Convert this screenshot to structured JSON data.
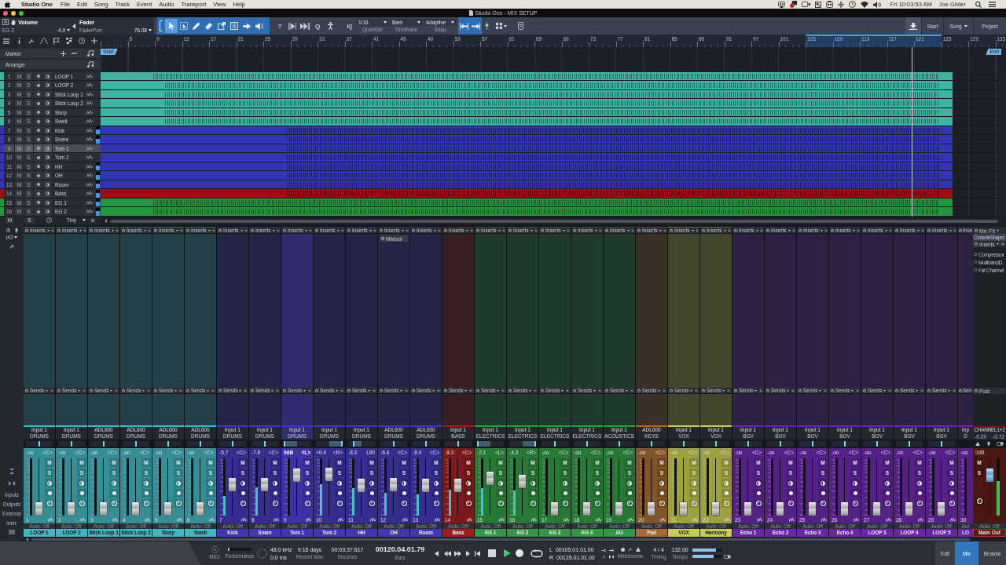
{
  "menu_bar": {
    "app": "Studio One",
    "items": [
      "File",
      "Edit",
      "Song",
      "Track",
      "Event",
      "Audio",
      "Transport",
      "View",
      "Help"
    ],
    "clock": "Fri 10:03:53 AM",
    "user": "Joe Gilder"
  },
  "window": {
    "title": "Studio One - MIX SETUP"
  },
  "toolbar": {
    "parameter": {
      "badge": "A",
      "name": "Volume",
      "track": "EG 2",
      "value": "-4.0"
    },
    "controller": {
      "name": "Fader",
      "device": "FaderPort",
      "value": "76.08"
    },
    "tools": [
      {
        "kind": "arrow",
        "selected": true
      },
      {
        "kind": "range",
        "selected": false
      },
      {
        "kind": "pencil",
        "selected": false
      },
      {
        "kind": "eraser",
        "selected": false
      },
      {
        "kind": "split",
        "selected": false
      },
      {
        "kind": "mute",
        "selected": false
      },
      {
        "kind": "bend",
        "selected": false
      },
      {
        "kind": "listen",
        "selected": false
      }
    ],
    "help": "?",
    "quantize_button": "Q",
    "iq": "IQ",
    "dropdowns": [
      {
        "value": "1/16",
        "label": "Quantize"
      },
      {
        "value": "Bars",
        "label": "Timebase"
      },
      {
        "value": "Adaptive",
        "label": "Snap"
      }
    ],
    "pages": [
      {
        "label": "Start",
        "kind": "plain"
      },
      {
        "label": "Song",
        "kind": "menu"
      },
      {
        "label": "Project",
        "kind": "plain"
      }
    ]
  },
  "arrange": {
    "rows": [
      {
        "label": "Marker",
        "kind": "marker"
      },
      {
        "label": "Arranger",
        "kind": "arranger"
      }
    ],
    "ruler": [
      {
        "label": "5",
        "loop": false
      },
      {
        "label": "9",
        "loop": false
      },
      {
        "label": "13",
        "loop": false
      },
      {
        "label": "17",
        "loop": false
      },
      {
        "label": "21",
        "loop": false
      },
      {
        "label": "25",
        "loop": false
      },
      {
        "label": "29",
        "loop": false
      },
      {
        "label": "33",
        "loop": false
      },
      {
        "label": "37",
        "loop": false
      },
      {
        "label": "41",
        "loop": false
      },
      {
        "label": "45",
        "loop": false
      },
      {
        "label": "49",
        "loop": false
      },
      {
        "label": "53",
        "loop": false
      },
      {
        "label": "57",
        "loop": false
      },
      {
        "label": "61",
        "loop": false
      },
      {
        "label": "65",
        "loop": false
      },
      {
        "label": "69",
        "loop": false
      },
      {
        "label": "73",
        "loop": false
      },
      {
        "label": "77",
        "loop": false
      },
      {
        "label": "81",
        "loop": false
      },
      {
        "label": "85",
        "loop": false
      },
      {
        "label": "89",
        "loop": false
      },
      {
        "label": "93",
        "loop": false
      },
      {
        "label": "97",
        "loop": false
      },
      {
        "label": "101",
        "loop": false
      },
      {
        "label": "105",
        "loop": true
      },
      {
        "label": "109",
        "loop": true
      },
      {
        "label": "113",
        "loop": true
      },
      {
        "label": "117",
        "loop": true
      },
      {
        "label": "121",
        "loop": true
      },
      {
        "label": "125",
        "loop": false
      },
      {
        "label": "129",
        "loop": false
      },
      {
        "label": "133",
        "loop": false
      }
    ],
    "markers": [
      {
        "label": "Start"
      },
      {
        "label": "End"
      }
    ],
    "playhead": {
      "level": 0.904
    },
    "tracks": [
      {
        "number": "1",
        "mute": "M",
        "solo": "S",
        "name": "LOOP 1",
        "color": "#3db5a0",
        "selected": false,
        "active": false
      },
      {
        "number": "2",
        "mute": "M",
        "solo": "S",
        "name": "LOOP 2",
        "color": "#3db5a0",
        "selected": false,
        "active": false
      },
      {
        "number": "3",
        "mute": "M",
        "solo": "S",
        "name": "Stick Loop 1",
        "color": "#3db5a0",
        "selected": false,
        "active": false
      },
      {
        "number": "4",
        "mute": "M",
        "solo": "S",
        "name": "Stick Loop 2",
        "color": "#3db5a0",
        "selected": false,
        "active": false
      },
      {
        "number": "5",
        "mute": "M",
        "solo": "S",
        "name": "Slurp",
        "color": "#3db5a0",
        "selected": false,
        "active": false
      },
      {
        "number": "6",
        "mute": "M",
        "solo": "S",
        "name": "Swell",
        "color": "#3db5a0",
        "selected": false,
        "active": false
      },
      {
        "number": "7",
        "mute": "M",
        "solo": "S",
        "name": "Kick",
        "color": "#3434b6",
        "selected": false,
        "active": true
      },
      {
        "number": "8",
        "mute": "M",
        "solo": "S",
        "name": "Snare",
        "color": "#3434b6",
        "selected": false,
        "active": true
      },
      {
        "number": "9",
        "mute": "M",
        "solo": "S",
        "name": "Tom 1",
        "color": "#3434b6",
        "selected": true,
        "active": false
      },
      {
        "number": "10",
        "mute": "M",
        "solo": "S",
        "name": "Tom 2",
        "color": "#3434b6",
        "selected": false,
        "active": false
      },
      {
        "number": "11",
        "mute": "M",
        "solo": "S",
        "name": "HH",
        "color": "#3434b6",
        "selected": false,
        "active": true
      },
      {
        "number": "12",
        "mute": "M",
        "solo": "S",
        "name": "OH",
        "color": "#3434b6",
        "selected": false,
        "active": true
      },
      {
        "number": "13",
        "mute": "M",
        "solo": "S",
        "name": "Room",
        "color": "#3434b6",
        "selected": false,
        "active": true
      },
      {
        "number": "14",
        "mute": "M",
        "solo": "S",
        "name": "Bass",
        "color": "#a20c10",
        "selected": false,
        "active": true
      },
      {
        "number": "15",
        "mute": "M",
        "solo": "S",
        "name": "EG 1",
        "color": "#23963e",
        "selected": false,
        "active": true
      },
      {
        "number": "16",
        "mute": "M",
        "solo": "S",
        "name": "EG 2",
        "color": "#23963e",
        "selected": false,
        "active": true
      }
    ],
    "footer": {
      "mute": "M",
      "solo": "S",
      "size": "Tiny"
    }
  },
  "mixer": {
    "panel": {
      "io": "I/O",
      "sections": [
        "Inputs",
        "Outputs",
        "External",
        "Instr."
      ]
    },
    "channels": [
      {
        "number": "1",
        "name": "LOOP 1",
        "color": "#3fb6c0",
        "selected": false,
        "inserts": "Inserts",
        "sends": "Sends",
        "input": "Input 1",
        "output": "DRUMS",
        "volume": "-oo",
        "pan": {
          "value": "<C>",
          "level": 0.5
        },
        "fader": {
          "level": 0
        },
        "mute": "M",
        "solo": "S",
        "automation": "Auto: Off"
      },
      {
        "number": "2",
        "name": "LOOP 2",
        "color": "#3fb6c0",
        "selected": false,
        "inserts": "Inserts",
        "sends": "Sends",
        "input": "Input 1",
        "output": "DRUMS",
        "volume": "-oo",
        "pan": {
          "value": "<C>",
          "level": 0.5
        },
        "fader": {
          "level": 0
        },
        "mute": "M",
        "solo": "S",
        "automation": "Auto: Off"
      },
      {
        "number": "3",
        "name": "Stick Loop 1",
        "color": "#3fb6c0",
        "selected": false,
        "inserts": "Inserts",
        "sends": "Sends",
        "input": "ADL600",
        "output": "DRUMS",
        "volume": "-oo",
        "pan": {
          "value": "<C>",
          "level": 0.5
        },
        "fader": {
          "level": 0
        },
        "mute": "M",
        "solo": "S",
        "automation": "Auto: Off"
      },
      {
        "number": "4",
        "name": "Stick Loop 2",
        "color": "#3fb6c0",
        "selected": false,
        "inserts": "Inserts",
        "sends": "Sends",
        "input": "ADL600",
        "output": "DRUMS",
        "volume": "-oo",
        "pan": {
          "value": "<C>",
          "level": 0.5
        },
        "fader": {
          "level": 0
        },
        "mute": "M",
        "solo": "S",
        "automation": "Auto: Off"
      },
      {
        "number": "5",
        "name": "Slurp",
        "color": "#3fb6c0",
        "selected": false,
        "inserts": "Inserts",
        "sends": "Sends",
        "input": "ADL600",
        "output": "DRUMS",
        "volume": "-oo",
        "pan": {
          "value": "<C>",
          "level": 0.5
        },
        "fader": {
          "level": 0
        },
        "mute": "M",
        "solo": "S",
        "automation": "Auto: Off"
      },
      {
        "number": "6",
        "name": "Swell",
        "color": "#3fb6c0",
        "selected": false,
        "inserts": "Inserts",
        "sends": "Sends",
        "input": "ADL600",
        "output": "DRUMS",
        "volume": "-oo",
        "pan": {
          "value": "<C>",
          "level": 0.5
        },
        "fader": {
          "level": 0
        },
        "mute": "M",
        "solo": "S",
        "automation": "Auto: Off"
      },
      {
        "number": "7",
        "name": "Kick",
        "color": "#4236b8",
        "selected": false,
        "inserts": "Inserts",
        "sends": "Sends",
        "input": "Input 1",
        "output": "DRUMS",
        "volume": "-5.7",
        "pan": {
          "value": "<C>",
          "level": 0.5
        },
        "fader": {
          "level": 0.55
        },
        "meter": {
          "level": 0.34
        },
        "mute": "M",
        "solo": "S",
        "automation": "Auto: Off"
      },
      {
        "number": "8",
        "name": "Snare",
        "color": "#4236b8",
        "selected": false,
        "inserts": "Inserts",
        "sends": "Sends",
        "input": "Input 1",
        "output": "DRUMS",
        "volume": "-7.8",
        "pan": {
          "value": "<C>",
          "level": 0.5
        },
        "fader": {
          "level": 0.55
        },
        "meter": {
          "level": 0.5
        },
        "mute": "M",
        "solo": "S",
        "automation": "Auto: Off"
      },
      {
        "number": "9",
        "name": "Tom 1",
        "color": "#4236b8",
        "selected": true,
        "inserts": "Inserts",
        "sends": "Sends",
        "input": "Input 1",
        "output": "DRUMS",
        "volume": "0dB",
        "pan": {
          "value": "<L>",
          "level": 0
        },
        "fader": {
          "level": 0.76
        },
        "mute": "M",
        "solo": "S",
        "automation": "Auto: Off"
      },
      {
        "number": "10",
        "name": "Tom 2",
        "color": "#4236b8",
        "selected": false,
        "inserts": "Inserts",
        "sends": "Sends",
        "input": "Input 1",
        "output": "DRUMS",
        "volume": "+0.4",
        "pan": {
          "value": "<R>",
          "level": 1
        },
        "fader": {
          "level": 0.78
        },
        "meter": {
          "level": 0.55
        },
        "mute": "M",
        "solo": "S",
        "automation": "Auto: Off"
      },
      {
        "number": "11",
        "name": "HH",
        "color": "#4236b8",
        "selected": false,
        "inserts": "Inserts",
        "sends": "Sends",
        "input": "Input 1",
        "output": "DRUMS",
        "volume": "-8.3",
        "pan": {
          "value": "L60",
          "level": 0.2
        },
        "fader": {
          "level": 0.53
        },
        "meter": {
          "level": 0.48
        },
        "mute": "M",
        "solo": "S",
        "automation": "Auto: Off"
      },
      {
        "number": "12",
        "name": "OH",
        "color": "#4236b8",
        "selected": false,
        "inserts": "Inserts",
        "plugins": [
          "Mixtool"
        ],
        "sends": "Sends",
        "input": "ADL600",
        "output": "DRUMS",
        "volume": "-6.4",
        "pan": {
          "value": "<C>",
          "level": 0.5
        },
        "fader": {
          "level": 0.56
        },
        "meter": {
          "level": 0.4
        },
        "mute": "M",
        "solo": "S",
        "automation": "Auto: Off"
      },
      {
        "number": "13",
        "name": "Room",
        "color": "#4236b8",
        "selected": false,
        "inserts": "Inserts",
        "sends": "Sends",
        "input": "ADL600",
        "output": "DRUMS",
        "volume": "-8.4",
        "pan": {
          "value": "<C>",
          "level": 0.5
        },
        "fader": {
          "level": 0.53
        },
        "meter": {
          "level": 0.37
        },
        "mute": "M",
        "solo": "S",
        "automation": "Auto: Off"
      },
      {
        "number": "14",
        "name": "Bass",
        "color": "#a01c1c",
        "selected": false,
        "inserts": "Inserts",
        "sends": "Sends",
        "input": "Input 1",
        "output": "BASS",
        "volume": "-8.3",
        "pan": {
          "value": "<C>",
          "level": 0.5
        },
        "fader": {
          "level": 0.53
        },
        "meter": {
          "level": 0.45
        },
        "mute": "M",
        "solo": "S",
        "automation": "Auto: Off"
      },
      {
        "number": "15",
        "name": "EG 1",
        "color": "#2f9a42",
        "selected": false,
        "inserts": "Inserts",
        "sends": "Sends",
        "input": "Input 1",
        "output": "ELECTRICS",
        "volume": "-2.1",
        "pan": {
          "value": "<L>",
          "level": 0
        },
        "fader": {
          "level": 0.69
        },
        "meter": {
          "level": 0.48
        },
        "mute": "M",
        "solo": "S",
        "automation": "Auto: Off"
      },
      {
        "number": "16",
        "name": "EG 2",
        "color": "#2f9a42",
        "selected": false,
        "inserts": "Inserts",
        "sends": "Sends",
        "input": "Input 1",
        "output": "ELECTRICS",
        "volume": "-4.3",
        "pan": {
          "value": "<R>",
          "level": 1
        },
        "fader": {
          "level": 0.63
        },
        "meter": {
          "level": 0.44
        },
        "mute": "M",
        "solo": "S",
        "automation": "Auto: Off"
      },
      {
        "number": "17",
        "name": "EG 3",
        "color": "#2f9a42",
        "selected": false,
        "inserts": "Inserts",
        "sends": "Sends",
        "input": "Input 1",
        "output": "ELECTRICS",
        "volume": "-oo",
        "pan": {
          "value": "<C>",
          "level": 0.5
        },
        "fader": {
          "level": 0
        },
        "mute": "M",
        "solo": "S",
        "automation": "Auto: Off"
      },
      {
        "number": "18",
        "name": "EG 4",
        "color": "#2f9a42",
        "selected": false,
        "inserts": "Inserts",
        "sends": "Sends",
        "input": "Input 1",
        "output": "ELECTRICS",
        "volume": "-oo",
        "pan": {
          "value": "<C>",
          "level": 0.5
        },
        "fader": {
          "level": 0
        },
        "mute": "M",
        "solo": "S",
        "automation": "Auto: Off"
      },
      {
        "number": "19",
        "name": "AG",
        "color": "#2f9a42",
        "selected": false,
        "inserts": "Inserts",
        "sends": "Sends",
        "input": "Input 1",
        "output": "ACOUSTICS",
        "volume": "-oo",
        "pan": {
          "value": "<C>",
          "level": 0.5
        },
        "fader": {
          "level": 0
        },
        "mute": "M",
        "solo": "S",
        "automation": "Auto: Off"
      },
      {
        "number": "20",
        "name": "Pad",
        "color": "#a86a2c",
        "selected": false,
        "inserts": "Inserts",
        "sends": "Sends",
        "input": "ADL600",
        "output": "KEYS",
        "volume": "-oo",
        "pan": {
          "value": "<C>",
          "level": 0.5
        },
        "fader": {
          "level": 0
        },
        "mute": "M",
        "solo": "S",
        "automation": "Auto: Off"
      },
      {
        "number": "21",
        "name": "VOX",
        "color": "#c9cf4a",
        "selected": false,
        "inserts": "Inserts",
        "sends": "Sends",
        "input": "Input 1",
        "output": "VOX",
        "volume": "-oo",
        "pan": {
          "value": "<C>",
          "level": 0.5
        },
        "fader": {
          "level": 0
        },
        "mute": "M",
        "solo": "S",
        "automation": "Auto: Off"
      },
      {
        "number": "22",
        "name": "Harmony",
        "color": "#c9cf4a",
        "selected": false,
        "inserts": "Inserts",
        "sends": "Sends",
        "input": "Input 1",
        "output": "VOX",
        "volume": "-oo",
        "pan": {
          "value": "<C>",
          "level": 0.5
        },
        "fader": {
          "level": 0
        },
        "mute": "M",
        "solo": "S",
        "automation": "Auto: Off"
      },
      {
        "number": "23",
        "name": "Echo 1",
        "color": "#6b25ad",
        "selected": false,
        "inserts": "Inserts",
        "sends": "Sends",
        "input": "Input 1",
        "output": "BGV",
        "volume": "-oo",
        "pan": {
          "value": "<C>",
          "level": 0.5
        },
        "fader": {
          "level": 0
        },
        "mute": "M",
        "solo": "S",
        "automation": "Auto: Off"
      },
      {
        "number": "24",
        "name": "Echo 2",
        "color": "#6b25ad",
        "selected": false,
        "inserts": "Inserts",
        "sends": "Sends",
        "input": "Input 1",
        "output": "BGV",
        "volume": "-oo",
        "pan": {
          "value": "<C>",
          "level": 0.5
        },
        "fader": {
          "level": 0
        },
        "mute": "M",
        "solo": "S",
        "automation": "Auto: Off"
      },
      {
        "number": "25",
        "name": "Echo 3",
        "color": "#6b25ad",
        "selected": false,
        "inserts": "Inserts",
        "sends": "Sends",
        "input": "Input 1",
        "output": "BGV",
        "volume": "-oo",
        "pan": {
          "value": "<C>",
          "level": 0.5
        },
        "fader": {
          "level": 0
        },
        "mute": "M",
        "solo": "S",
        "automation": "Auto: Off"
      },
      {
        "number": "26",
        "name": "Echo 4",
        "color": "#6b25ad",
        "selected": false,
        "inserts": "Inserts",
        "sends": "Sends",
        "input": "Input 1",
        "output": "BGV",
        "volume": "-oo",
        "pan": {
          "value": "<C>",
          "level": 0.5
        },
        "fader": {
          "level": 0
        },
        "mute": "M",
        "solo": "S",
        "automation": "Auto: Off"
      },
      {
        "number": "27",
        "name": "LOOP 3",
        "color": "#6b25ad",
        "selected": false,
        "inserts": "Inserts",
        "sends": "Sends",
        "input": "Input 1",
        "output": "BGV",
        "volume": "-oo",
        "pan": {
          "value": "<C>",
          "level": 0.5
        },
        "fader": {
          "level": 0
        },
        "mute": "M",
        "solo": "S",
        "automation": "Auto: Off"
      },
      {
        "number": "28",
        "name": "LOOP 4",
        "color": "#6b25ad",
        "selected": false,
        "inserts": "Inserts",
        "sends": "Sends",
        "input": "Input 1",
        "output": "BGV",
        "volume": "-oo",
        "pan": {
          "value": "<C>",
          "level": 0.5
        },
        "fader": {
          "level": 0
        },
        "mute": "M",
        "solo": "S",
        "automation": "Auto: Off"
      },
      {
        "number": "29",
        "name": "LOOP 5",
        "color": "#6b25ad",
        "selected": false,
        "inserts": "Inserts",
        "sends": "Sends",
        "input": "Input 1",
        "output": "BGV",
        "volume": "-oo",
        "pan": {
          "value": "<C>",
          "level": 0.5
        },
        "fader": {
          "level": 0
        },
        "mute": "M",
        "solo": "S",
        "automation": "Auto: Off"
      },
      {
        "number": "30",
        "name": "LO",
        "color": "#6b25ad",
        "selected": false,
        "inserts": "Inse",
        "sends": "Sen",
        "input": "Inp",
        "output": "D",
        "volume": "-oo",
        "automation": "Aut"
      }
    ],
    "main_out": {
      "fx_label": "Mix FX",
      "fx": [
        "ConsoleShaper"
      ],
      "inserts": "Inserts",
      "plugins": [
        "Compressor",
        "MultibandD..",
        "Fat Channel"
      ],
      "sends": "Post",
      "output": "CHANNEL1+2",
      "peaks": [
        "-0.29",
        "-0.72"
      ],
      "volume": "0dB",
      "fader": {
        "level": 0.76
      },
      "meter": {
        "level": 0.6
      },
      "mute": "M",
      "solo": "S",
      "automation": "Auto: Off",
      "name": "Main Out"
    }
  },
  "transport": {
    "midi": "MIDI",
    "performance": {
      "label": "Performance",
      "level": 0.08
    },
    "sample_rate": "48.0 kHz",
    "latency": "0.0 ms",
    "readouts": [
      {
        "value": "9:15 days",
        "label": "Record Max",
        "kind": "plain"
      },
      {
        "value": "00:03:37.817",
        "label": "Seconds",
        "kind": "plain"
      },
      {
        "value": "00120.04.01.79",
        "label": "Bars",
        "kind": "main"
      }
    ],
    "buttons": [
      {
        "kind": "previous"
      },
      {
        "kind": "rewind"
      },
      {
        "kind": "forward"
      },
      {
        "kind": "next"
      },
      {
        "kind": "start"
      },
      {
        "kind": "stop"
      },
      {
        "kind": "play"
      },
      {
        "kind": "record"
      },
      {
        "kind": "loop"
      }
    ],
    "locators": [
      {
        "letter": "L",
        "value": "00105.01.01.00"
      },
      {
        "letter": "R",
        "value": "00125.01.01.00"
      }
    ],
    "metronome": "Metronome",
    "timing": {
      "value": "4 / 4",
      "label": "Timing"
    },
    "tempo": {
      "value": "132.00",
      "label": "Tempo"
    },
    "levels": [
      {
        "level": 0.8
      },
      {
        "level": 0.72
      }
    ],
    "views": [
      {
        "label": "Edit",
        "selected": false
      },
      {
        "label": "Mix",
        "selected": true
      },
      {
        "label": "Browse",
        "selected": false
      }
    ]
  }
}
